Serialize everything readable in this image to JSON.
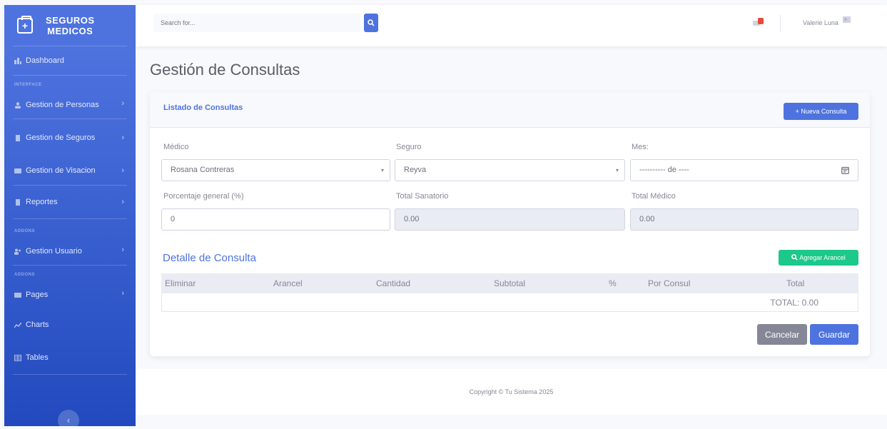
{
  "sidebar": {
    "brand_line1": "SEGUROS",
    "brand_line2": "MEDICOS",
    "brand_icon": "medkit-icon",
    "dashboard": "Dashboard",
    "heading_interface": "INTERFACE",
    "items": [
      {
        "label": "Gestion de Personas",
        "icon": "user-icon"
      },
      {
        "label": "Gestion de Seguros",
        "icon": "file-icon"
      },
      {
        "label": "Gestion de Visacion",
        "icon": "card-icon"
      },
      {
        "label": "Reportes",
        "icon": "doc-icon"
      }
    ],
    "heading_addons1": "ADDONS",
    "gestion_usuario": "Gestion Usuario",
    "heading_addons2": "ADDONS",
    "pages": "Pages",
    "charts": "Charts",
    "tables": "Tables"
  },
  "topbar": {
    "search_placeholder": "Search for...",
    "alerts_badge": "",
    "user_name": "Valerie Luna"
  },
  "page": {
    "title": "Gestión de Consultas"
  },
  "card": {
    "header_title": "Listado de Consultas",
    "new_button": "+ Nueva Consulta",
    "medico_label": "Médico",
    "medico_value": "Rosana Contreras",
    "seguro_label": "Seguro",
    "seguro_value": "Reyva",
    "mes_label": "Mes:",
    "mes_value": "---------- de ----",
    "porcentaje_label": "Porcentaje general (%)",
    "porcentaje_value": "0",
    "sanatorio_label": "Total Sanatorio",
    "sanatorio_value": "0.00",
    "medico_total_label": "Total Médico",
    "medico_total_value": "0.00",
    "detalle_title": "Detalle de Consulta",
    "add_button": "Agregar Arancel",
    "columns": [
      "Eliminar",
      "Arancel",
      "Cantidad",
      "Subtotal",
      "%",
      "Por Consul",
      "Total"
    ],
    "total_text": "TOTAL: 0.00",
    "cancel_button": "Cancelar",
    "save_button": "Guardar"
  },
  "footer": {
    "copyright": "Copyright © Tu Sistema 2025"
  },
  "colors": {
    "primary": "#4e73df",
    "success": "#1cc88a",
    "secondary": "#858796",
    "danger": "#e74a3b"
  }
}
